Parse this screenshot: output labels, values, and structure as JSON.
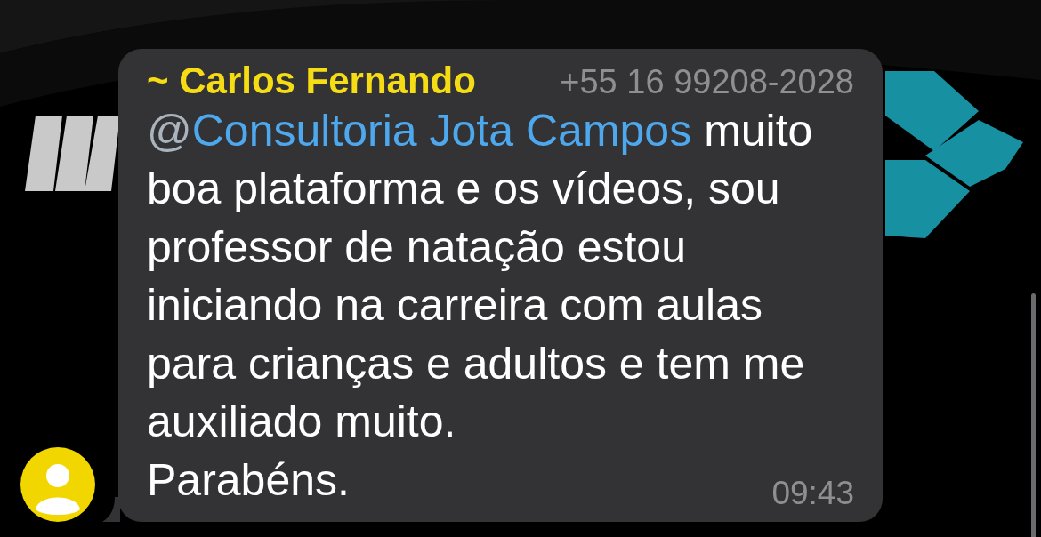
{
  "message": {
    "sender_prefix": "~",
    "sender": "Carlos Fernando",
    "phone": "+55 16 99208-2028",
    "mention_prefix": "@",
    "mention": "Consultoria Jota Campos",
    "lines": [
      "muito",
      "boa plataforma e os vídeos, sou",
      "professor de natação estou",
      "iniciando na carreira com aulas",
      "para crianças e adultos e tem me",
      "auxiliado muito."
    ],
    "closing": "Parabéns.",
    "time": "09:43"
  }
}
